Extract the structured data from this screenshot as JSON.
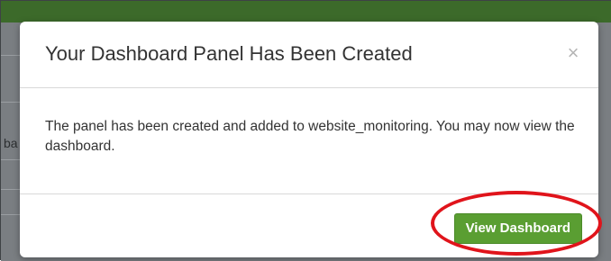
{
  "modal": {
    "title": "Your Dashboard Panel Has Been Created",
    "close_icon": "close-icon",
    "close_glyph": "×",
    "body_text": "The panel has been created and added to website_monitoring. You may now view the dashboard.",
    "primary_button_label": "View Dashboard"
  },
  "background": {
    "snippet": "ba"
  },
  "colors": {
    "top_bar": "#3c6a2a",
    "primary_button": "#5a9e32",
    "highlight_ring": "#e0141b"
  }
}
